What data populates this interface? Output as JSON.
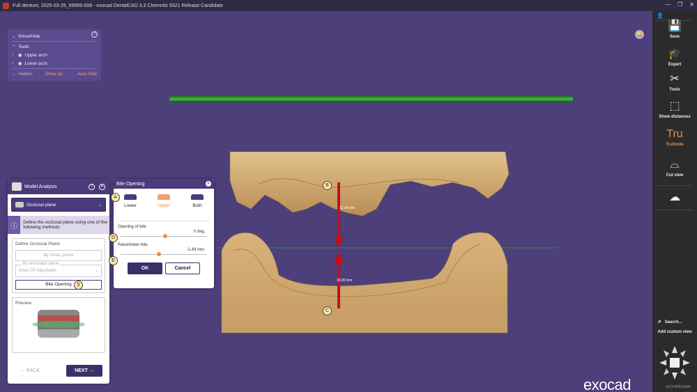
{
  "window": {
    "title": "Full denture, 2025-03-25_99999-009 - exocad DentalCAD 3.3 Chemnitz 9321 Release Candidate",
    "controls": [
      "—",
      "❐",
      "✕"
    ]
  },
  "show_hide": {
    "title": "Show/Hide",
    "help": "?",
    "teeth": "Teeth",
    "upper_arch": "Upper arch",
    "lower_arch": "Lower arch",
    "hidden": "Hidden",
    "show_all": "Show all",
    "auto_hide": "Auto hide"
  },
  "model_analysis": {
    "title": "Model Analysis",
    "selected": "Occlusal plane",
    "info_text": "Define the occlusal plane using one of the following methods:",
    "define_title": "Define Occlusal Plane",
    "by_three_points": "By three points",
    "by_articulator_plane": "By articulator plane",
    "articulator_value": "Artex CR Adjustable",
    "bite_opening_btn": "Bite Opening",
    "preview_title": "Preview",
    "back": "BACK",
    "next": "NEXT"
  },
  "bite_opening": {
    "title": "Bite Opening",
    "tabs": [
      {
        "label": "Lower",
        "selected": false
      },
      {
        "label": "Upper",
        "selected": true
      },
      {
        "label": "Both",
        "selected": false
      }
    ],
    "opening_label": "Opening of bite",
    "opening_value": "0 deg",
    "raise_label": "Raise/lower bite",
    "raise_value": "-1.49 mm",
    "ok": "OK",
    "cancel": "Cancel"
  },
  "callouts": {
    "a": "A",
    "b": "B",
    "c": "C",
    "d": "D",
    "e": "E",
    "five": "5"
  },
  "measurements": {
    "upper": "21.04 mm",
    "lower": "18.90 mm"
  },
  "toolbar": {
    "user": "👤",
    "save": "Save",
    "expert": "Expert",
    "tools": "Tools",
    "show_distances": "Show distances",
    "trusmile_icon": "Tru",
    "trusmile": "TruSmile",
    "cut_view": "Cut view",
    "search": "Search...",
    "add_custom_view": "Add custom view",
    "version": "v3.3-9321rc64"
  },
  "brand": "exocad",
  "colors": {
    "background": "#4d3f7a",
    "accent": "#f08c3c",
    "panel_header": "#4a3c7a",
    "arrow": "#c0101a",
    "plane": "#1a8a1a",
    "model": "#d6b07a"
  }
}
